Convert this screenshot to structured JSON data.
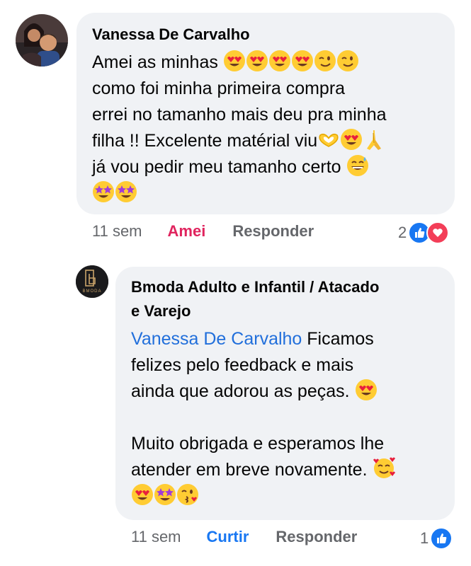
{
  "comment": {
    "author": "Vanessa De Carvalho",
    "lines": [
      "Amei as minhas",
      "como foi minha primeira compra",
      "errei no tamanho mais deu pra minha",
      "filha !! Excelente matérial viu",
      "já vou pedir meu tamanho certo"
    ],
    "time": "11 sem",
    "reaction_label": "Amei",
    "reply_label": "Responder",
    "reaction_count": "2"
  },
  "reply": {
    "author_line1": "Bmoda Adulto e Infantil / Atacado",
    "author_line2": "e Varejo",
    "mention": "Vanessa De Carvalho",
    "line1_rest": " Ficamos",
    "lines": [
      "felizes pelo feedback e mais",
      "ainda que adorou as peças.",
      "",
      "Muito obrigada e esperamos lhe",
      "atender em breve novamente."
    ],
    "avatar_logo_text": "BMODA",
    "time": "11 sem",
    "reaction_label": "Curtir",
    "reply_label": "Responder",
    "reaction_count": "1"
  },
  "emoji_names": [
    "heart-eyes",
    "wink",
    "heart-hands",
    "folded-hands",
    "grinning-sweat",
    "star-struck",
    "smiling-hearts",
    "kissing-heart"
  ],
  "colors": {
    "bubble": "#f0f2f5",
    "mention": "#216fdb",
    "love_action": "#e0245e",
    "like_action": "#1877f2",
    "muted": "#65676b"
  }
}
